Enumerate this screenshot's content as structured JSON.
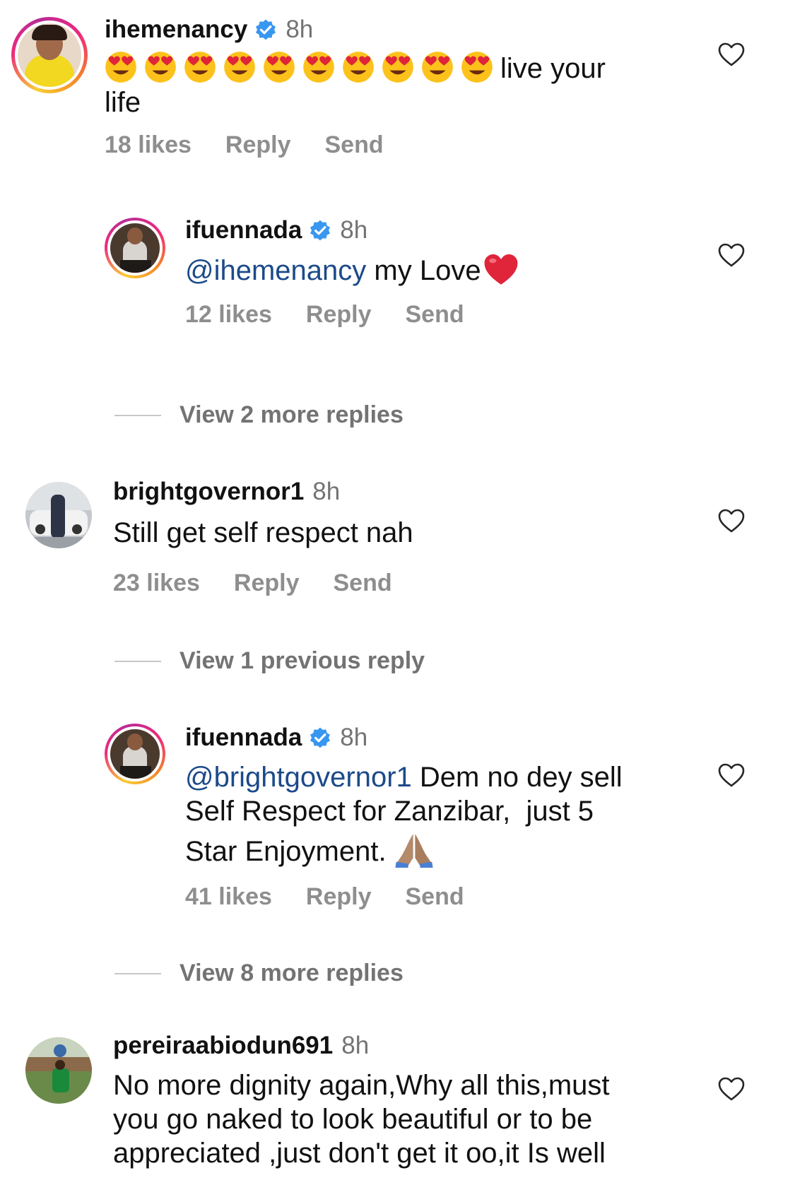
{
  "comments": [
    {
      "username": "ihemenancy",
      "verified": true,
      "time": "8h",
      "text_suffix": "live your life",
      "emoji_count": 10,
      "emoji": "heart-eyes",
      "likes": "18 likes",
      "reply": "Reply",
      "send": "Send"
    },
    {
      "username": "ifuennada",
      "verified": true,
      "time": "8h",
      "mention": "@ihemenancy",
      "text": " my Love",
      "trailing_emoji": "red-heart",
      "likes": "12 likes",
      "reply": "Reply",
      "send": "Send"
    },
    {
      "username": "brightgovernor1",
      "verified": false,
      "time": "8h",
      "text": "Still get self respect nah",
      "likes": "23 likes",
      "reply": "Reply",
      "send": "Send"
    },
    {
      "username": "ifuennada",
      "verified": true,
      "time": "8h",
      "mention": "@brightgovernor1",
      "text_line1": " Dem no dey sell",
      "text_line2": "Self Respect for Zanzibar,  just 5",
      "text_line3": "Star Enjoyment. ",
      "trailing_emoji": "folded-hands",
      "likes": "41 likes",
      "reply": "Reply",
      "send": "Send"
    },
    {
      "username": "pereiraabiodun691",
      "verified": false,
      "time": "8h",
      "text_line1": "No more dignity again,Why all this,must",
      "text_line2": "you go naked to look beautiful or to be",
      "text_line3": "appreciated ,just don't get it oo,it Is well"
    }
  ],
  "view_more": [
    "View 2 more replies",
    "View 1 previous reply",
    "View 8 more replies"
  ],
  "colors": {
    "mention": "#1c4a8a",
    "verified": "#3897f0",
    "secondary_text": "#8e8e8e"
  }
}
